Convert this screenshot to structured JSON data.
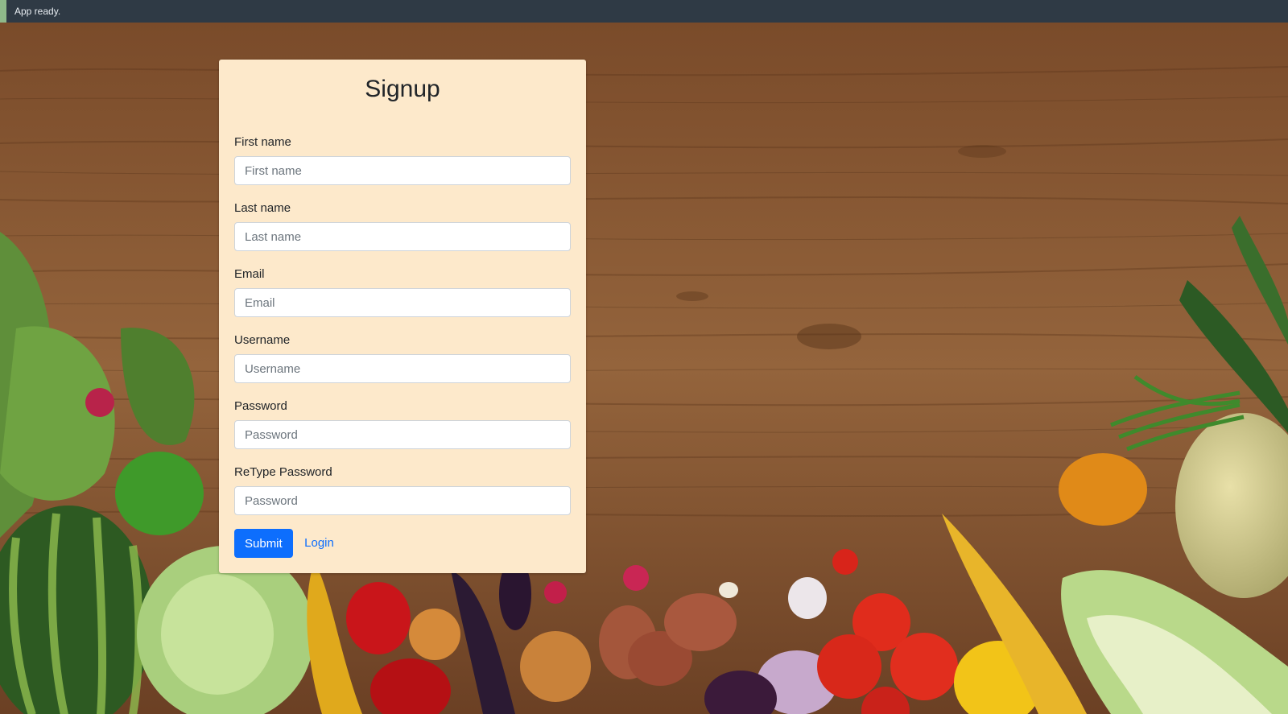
{
  "status_bar": {
    "text": "App ready."
  },
  "form": {
    "title": "Signup",
    "fields": [
      {
        "label": "First name",
        "placeholder": "First name",
        "value": ""
      },
      {
        "label": "Last name",
        "placeholder": "Last name",
        "value": ""
      },
      {
        "label": "Email",
        "placeholder": "Email",
        "value": ""
      },
      {
        "label": "Username",
        "placeholder": "Username",
        "value": ""
      },
      {
        "label": "Password",
        "placeholder": "Password",
        "value": ""
      },
      {
        "label": "ReType Password",
        "placeholder": "Password",
        "value": ""
      }
    ],
    "submit_label": "Submit",
    "login_label": "Login"
  },
  "colors": {
    "card_background": "#fde9cb",
    "primary": "#0d6efd",
    "status_bar": "#2f3a45",
    "wood": "#8a5a34"
  }
}
